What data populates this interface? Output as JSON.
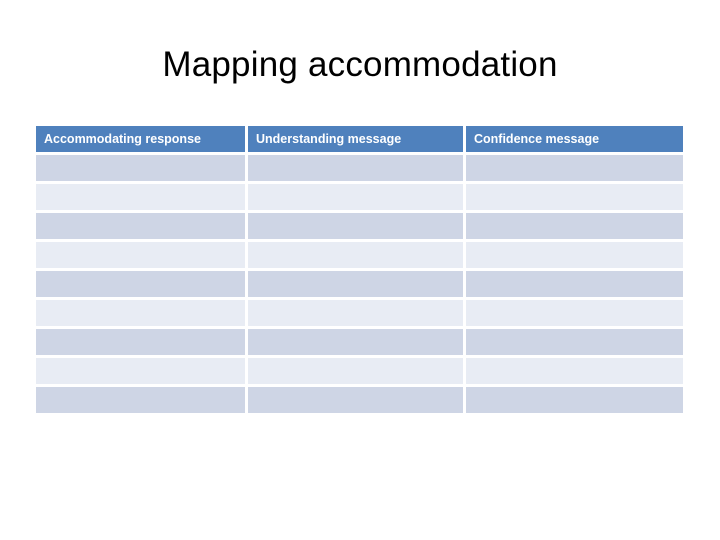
{
  "slide": {
    "title": "Mapping accommodation",
    "background_color": "#ffffff"
  },
  "table": {
    "name": "mapping-accommodation-table",
    "header_background_color": "#4f81bd",
    "header_text_color": "#ffffff",
    "row_shade_dark_color": "#ced5e5",
    "row_shade_light_color": "#e8ecf4",
    "gridline_color": "#ffffff",
    "columns": [
      {
        "label": "Accommodating response"
      },
      {
        "label": "Understanding message"
      },
      {
        "label": "Confidence message"
      }
    ],
    "rows": [
      {
        "shade": "dark",
        "cells": [
          "",
          "",
          ""
        ]
      },
      {
        "shade": "light",
        "cells": [
          "",
          "",
          ""
        ]
      },
      {
        "shade": "dark",
        "cells": [
          "",
          "",
          ""
        ]
      },
      {
        "shade": "light",
        "cells": [
          "",
          "",
          ""
        ]
      },
      {
        "shade": "dark",
        "cells": [
          "",
          "",
          ""
        ]
      },
      {
        "shade": "light",
        "cells": [
          "",
          "",
          ""
        ]
      },
      {
        "shade": "dark",
        "cells": [
          "",
          "",
          ""
        ]
      },
      {
        "shade": "light",
        "cells": [
          "",
          "",
          ""
        ]
      },
      {
        "shade": "dark",
        "cells": [
          "",
          "",
          ""
        ]
      }
    ]
  }
}
